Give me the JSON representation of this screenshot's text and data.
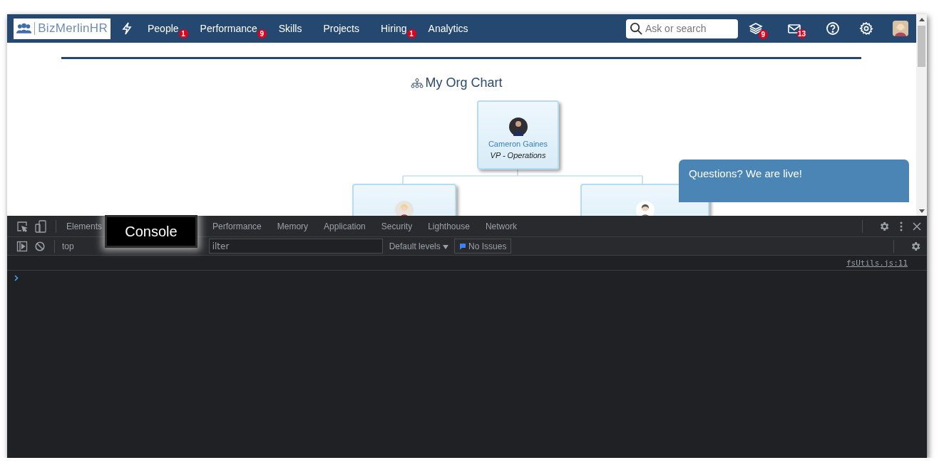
{
  "navbar": {
    "logo": "BizMerlinHR",
    "nav_items": [
      {
        "label": "People",
        "badge": "1"
      },
      {
        "label": "Performance",
        "badge": "9"
      },
      {
        "label": "Skills"
      },
      {
        "label": "Projects"
      },
      {
        "label": "Hiring",
        "badge": "1"
      },
      {
        "label": "Analytics"
      }
    ],
    "search": {
      "placeholder": "Ask or search"
    },
    "icons": [
      {
        "kind": "stack",
        "badge": "9"
      },
      {
        "kind": "mail",
        "badge": "13"
      },
      {
        "kind": "help"
      },
      {
        "kind": "settings"
      },
      {
        "kind": "avatar"
      }
    ]
  },
  "org_chart": {
    "title": "My Org Chart",
    "root": {
      "name": "Cameron Gaines",
      "title": "VP - Operations",
      "children": [
        {
          "kind": "person"
        },
        {
          "kind": "person"
        }
      ]
    }
  },
  "chat_widget": {
    "text": "Questions? We are live!"
  },
  "devtools": {
    "tabs": [
      {
        "label": "Elements",
        "selected": false
      },
      {
        "label": "Performance",
        "selected": false
      },
      {
        "label": "Memory",
        "selected": false
      },
      {
        "label": "Application",
        "selected": false
      },
      {
        "label": "Security",
        "selected": false
      },
      {
        "label": "Lighthouse",
        "selected": false
      },
      {
        "label": "Network",
        "selected": false
      }
    ],
    "callout": "Console",
    "context": "top",
    "filter": {
      "placeholder": "ilter"
    },
    "levels": "Default levels",
    "issues": "No Issues",
    "source_link": "fsUtils.js:11"
  }
}
